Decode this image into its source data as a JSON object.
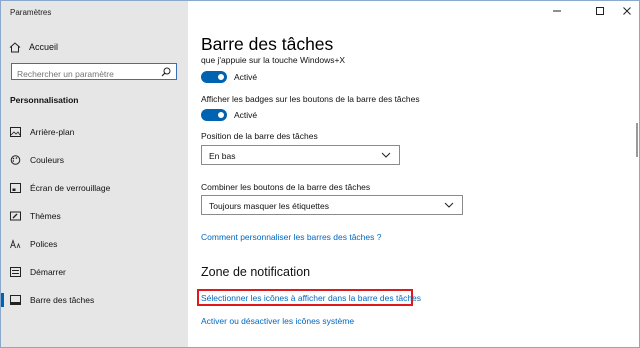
{
  "window": {
    "title": "Paramètres"
  },
  "sidebar": {
    "home_label": "Accueil",
    "search_placeholder": "Rechercher un paramètre",
    "section": "Personnalisation",
    "items": [
      {
        "label": "Arrière-plan",
        "icon": "image-icon",
        "active": false
      },
      {
        "label": "Couleurs",
        "icon": "palette-icon",
        "active": false
      },
      {
        "label": "Écran de verrouillage",
        "icon": "lock-screen-icon",
        "active": false
      },
      {
        "label": "Thèmes",
        "icon": "brush-icon",
        "active": false
      },
      {
        "label": "Polices",
        "icon": "font-icon",
        "active": false
      },
      {
        "label": "Démarrer",
        "icon": "start-icon",
        "active": false
      },
      {
        "label": "Barre des tâches",
        "icon": "taskbar-icon",
        "active": true
      }
    ]
  },
  "main": {
    "title": "Barre des tâches",
    "peek_text": "que j'appuie sur la touche Windows+X",
    "toggle1_state": "Activé",
    "badges_label": "Afficher les badges sur les boutons de la barre des tâches",
    "toggle2_state": "Activé",
    "position_label": "Position de la barre des tâches",
    "position_value": "En bas",
    "combine_label": "Combiner les boutons de la barre des tâches",
    "combine_value": "Toujours masquer les étiquettes",
    "customize_link": "Comment personnaliser les barres des tâches ?",
    "notification_heading": "Zone de notification",
    "select_icons_link": "Sélectionner les icônes à afficher dans la barre des tâches",
    "system_icons_link": "Activer ou désactiver les icônes système"
  },
  "colors": {
    "accent": "#0063b1",
    "link": "#0067c0",
    "highlight": "#e0191f",
    "sidebar_bg": "#e6e6e6"
  }
}
